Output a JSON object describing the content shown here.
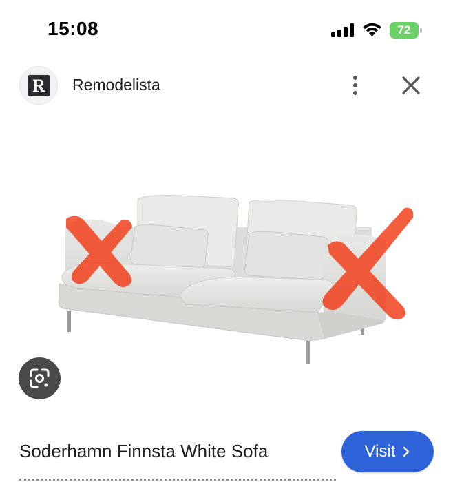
{
  "status_bar": {
    "time": "15:08",
    "battery_level": "72",
    "battery_color": "#6dd16a"
  },
  "source": {
    "logo_letter": "R",
    "name": "Remodelista",
    "more_icon": "more-vert-icon",
    "close_icon": "close-icon"
  },
  "image": {
    "subject": "sofa",
    "markings": "two red brush-stroke X marks over armrests"
  },
  "lens_icon": "lens-search-icon",
  "product": {
    "title": "Soderhamn Finnsta White Sofa"
  },
  "visit_button": {
    "label": "Visit",
    "color": "#2e62d9"
  }
}
